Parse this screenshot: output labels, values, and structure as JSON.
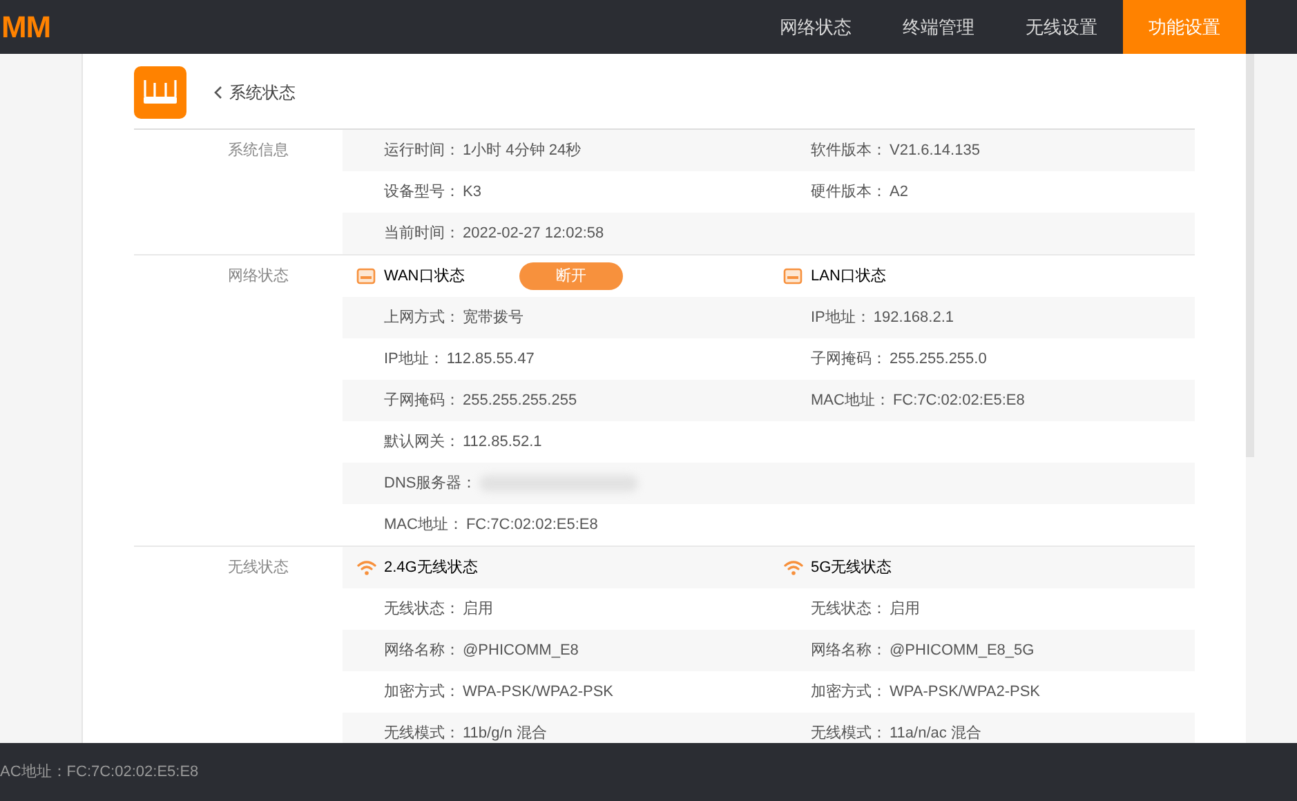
{
  "nav": {
    "logo": "MM",
    "items": [
      {
        "label": "网络状态",
        "selected": false
      },
      {
        "label": "终端管理",
        "selected": false
      },
      {
        "label": "无线设置",
        "selected": false
      },
      {
        "label": "功能设置",
        "selected": true
      }
    ]
  },
  "page": {
    "title": "系统状态"
  },
  "sections": [
    {
      "title": "系统信息",
      "rows": [
        {
          "left": {
            "kind": "pair",
            "label": "运行时间：",
            "value": "1小时 4分钟 24秒"
          },
          "right": {
            "kind": "pair",
            "label": "软件版本：",
            "value": "V21.6.14.135"
          }
        },
        {
          "left": {
            "kind": "pair",
            "label": "设备型号：",
            "value": "K3"
          },
          "right": {
            "kind": "pair",
            "label": "硬件版本：",
            "value": "A2"
          }
        },
        {
          "left": {
            "kind": "pair",
            "label": "当前时间：",
            "value": "2022-02-27 12:02:58"
          }
        }
      ]
    },
    {
      "title": "网络状态",
      "rows": [
        {
          "left": {
            "kind": "port_header",
            "label": "WAN口状态",
            "button": "断开"
          },
          "right": {
            "kind": "port_header",
            "label": "LAN口状态"
          }
        },
        {
          "left": {
            "kind": "pair",
            "label": "上网方式：",
            "value": "宽带拨号"
          },
          "right": {
            "kind": "pair",
            "label": "IP地址：",
            "value": "192.168.2.1"
          }
        },
        {
          "left": {
            "kind": "pair",
            "label": "IP地址：",
            "value": "112.85.55.47"
          },
          "right": {
            "kind": "pair",
            "label": "子网掩码：",
            "value": "255.255.255.0"
          }
        },
        {
          "left": {
            "kind": "pair",
            "label": "子网掩码：",
            "value": "255.255.255.255"
          },
          "right": {
            "kind": "pair",
            "label": "MAC地址：",
            "value": "FC:7C:02:02:E5:E8"
          }
        },
        {
          "left": {
            "kind": "pair",
            "label": "默认网关：",
            "value": "112.85.52.1"
          }
        },
        {
          "left": {
            "kind": "blurred",
            "label": "DNS服务器："
          }
        },
        {
          "left": {
            "kind": "pair",
            "label": "MAC地址：",
            "value": "FC:7C:02:02:E5:E8"
          }
        }
      ]
    },
    {
      "title": "无线状态",
      "rows": [
        {
          "left": {
            "kind": "wifi_header",
            "label": "2.4G无线状态"
          },
          "right": {
            "kind": "wifi_header",
            "label": "5G无线状态"
          }
        },
        {
          "left": {
            "kind": "pair",
            "label": "无线状态：",
            "value": "启用"
          },
          "right": {
            "kind": "pair",
            "label": "无线状态：",
            "value": "启用"
          }
        },
        {
          "left": {
            "kind": "pair",
            "label": "网络名称：",
            "value": "@PHICOMM_E8"
          },
          "right": {
            "kind": "pair",
            "label": "网络名称：",
            "value": "@PHICOMM_E8_5G"
          }
        },
        {
          "left": {
            "kind": "pair",
            "label": "加密方式：",
            "value": "WPA-PSK/WPA2-PSK"
          },
          "right": {
            "kind": "pair",
            "label": "加密方式：",
            "value": "WPA-PSK/WPA2-PSK"
          }
        },
        {
          "left": {
            "kind": "pair",
            "label": "无线模式：",
            "value": "11b/g/n 混合"
          },
          "right": {
            "kind": "pair",
            "label": "无线模式：",
            "value": "11a/n/ac 混合"
          }
        }
      ]
    }
  ],
  "footer": {
    "text": "AC地址：FC:7C:02:02:E5:E8"
  }
}
